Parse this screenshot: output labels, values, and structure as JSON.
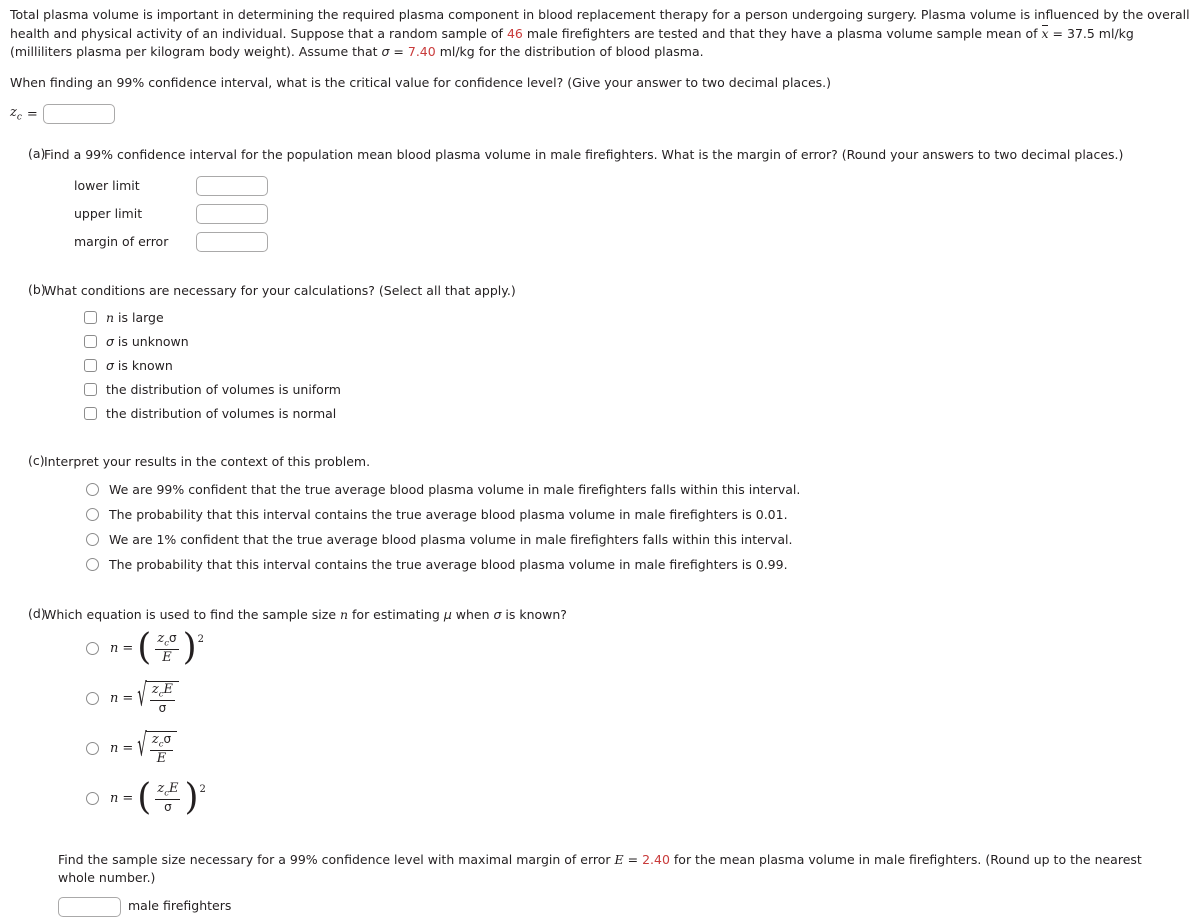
{
  "intro": {
    "seg1": "Total plasma volume is important in determining the required plasma component in blood replacement therapy for a person undergoing surgery. Plasma volume is influenced by the overall health and physical activity of an individual. Suppose that a random sample of ",
    "sample_size": "46",
    "seg2": " male firefighters are tested and that they have a plasma volume sample mean of ",
    "xbar_symbol": "x",
    "seg3": " = 37.5 ml/kg (milliliters plasma per kilogram body weight). Assume that ",
    "sigma_symbol": "σ",
    "seg4": " = ",
    "sigma_value": "7.40",
    "seg5": " ml/kg for the distribution of blood plasma."
  },
  "critical_value_question": {
    "text": "When finding an 99% confidence interval, what is the critical value for confidence level? (Give your answer to two decimal places.)",
    "label_z": "z",
    "label_sub": "c",
    "label_eq": "=",
    "input_value": "",
    "input_placeholder": ""
  },
  "parts": {
    "a": {
      "letter": "(a)",
      "title": "Find a 99% confidence interval for the population mean blood plasma volume in male firefighters. What is the margin of error? (Round your answers to two decimal places.)",
      "fields": [
        {
          "label": "lower limit",
          "value": "",
          "name": "lower-limit-input"
        },
        {
          "label": "upper limit",
          "value": "",
          "name": "upper-limit-input"
        },
        {
          "label": "margin of error",
          "value": "",
          "name": "margin-of-error-input"
        }
      ]
    },
    "b": {
      "letter": "(b)",
      "title": "What conditions are necessary for your calculations? (Select all that apply.)",
      "options": [
        {
          "pre": "n",
          "post": " is large",
          "italic_first": true,
          "checked": false
        },
        {
          "pre": "σ",
          "post": " is unknown",
          "italic_first": false,
          "checked": false
        },
        {
          "pre": "σ",
          "post": " is known",
          "italic_first": false,
          "checked": false
        },
        {
          "pre": "",
          "post": "the distribution of volumes is uniform",
          "italic_first": false,
          "checked": false
        },
        {
          "pre": "",
          "post": "the distribution of volumes is normal",
          "italic_first": false,
          "checked": false
        }
      ]
    },
    "c": {
      "letter": "(c)",
      "title": "Interpret your results in the context of this problem.",
      "options": [
        {
          "label": "We are 99% confident that the true average blood plasma volume in male firefighters falls within this interval.",
          "checked": false
        },
        {
          "label": "The probability that this interval contains the true average blood plasma volume in male firefighters is 0.01.",
          "checked": false
        },
        {
          "label": "We are 1% confident that the true average blood plasma volume in male firefighters falls within this interval.",
          "checked": false
        },
        {
          "label": "The probability that this interval contains the true average blood plasma volume in male firefighters is 0.99.",
          "checked": false
        }
      ]
    },
    "d": {
      "letter": "(d)",
      "title_pre": "Which equation is used to find the sample size ",
      "title_n": "n",
      "title_mid": " for estimating ",
      "title_mu": "μ",
      "title_post": " when ",
      "title_sigma": "σ",
      "title_end": " is known?",
      "equations": [
        {
          "form": "power",
          "n": "n",
          "eq": "=",
          "numerator": "z_c σ",
          "denominator": "E",
          "exponent": "2",
          "checked": false
        },
        {
          "form": "radical",
          "n": "n",
          "eq": "=",
          "numerator": "z_c E",
          "denominator": "σ",
          "exponent": "",
          "checked": false
        },
        {
          "form": "radical",
          "n": "n",
          "eq": "=",
          "numerator": "z_c σ",
          "denominator": "E",
          "exponent": "",
          "checked": false
        },
        {
          "form": "power",
          "n": "n",
          "eq": "=",
          "numerator": "z_c E",
          "denominator": "σ",
          "exponent": "2",
          "checked": false
        }
      ]
    }
  },
  "footer": {
    "seg1": "Find the sample size necessary for a 99% confidence level with maximal margin of error ",
    "E_symbol": "E",
    "seg2": " = ",
    "E_value": "2.40",
    "seg3": " for the mean plasma volume in male firefighters. (Round up to the nearest whole number.)",
    "input_value": "",
    "unit_label": "male firefighters"
  },
  "colors": {
    "accent_red": "#c93b3b",
    "text": "#231f20",
    "input_border": "#aaa9a9",
    "control_border": "#8c8c8c"
  }
}
